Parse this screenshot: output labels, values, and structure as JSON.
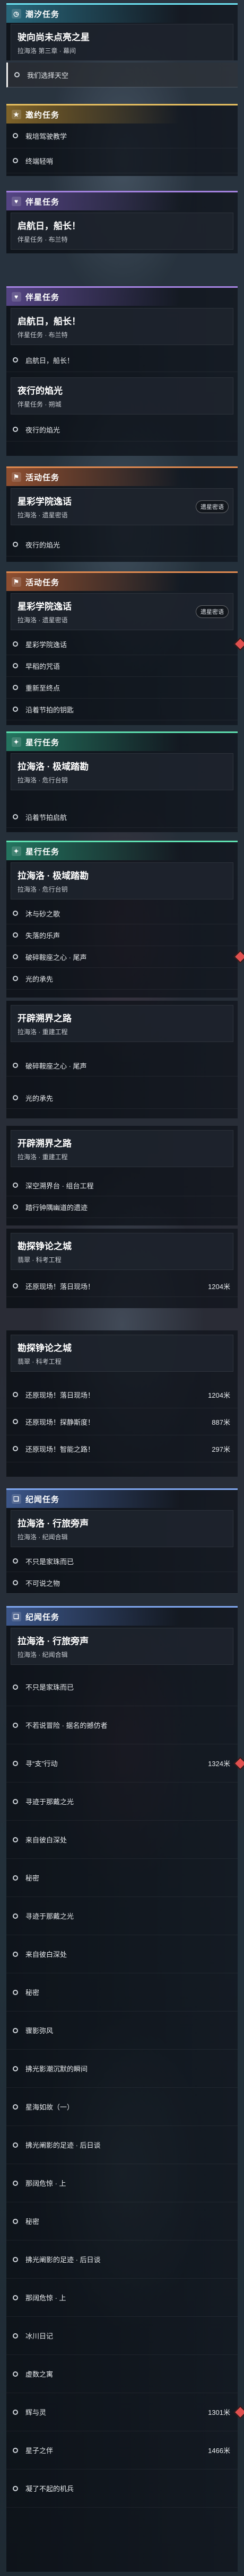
{
  "colors": {
    "daily": "#6be0f0",
    "errand": "#e8c060",
    "companion": "#a482e0",
    "event": "#e08a50",
    "star": "#5ee0b0",
    "trailblaze": "#80a8f0",
    "bounty": "#e0504f"
  },
  "icons": {
    "daily": "clock-icon",
    "errand": "star-icon",
    "companion": "heart-icon",
    "event": "flag-icon",
    "star": "sparkle-icon",
    "trailblaze": "book-icon",
    "bounty": "diamond-icon"
  },
  "s1": {
    "head": "潮汐任务",
    "quest": {
      "title": "驶向尚未点亮之星",
      "sub": "拉海洛 第三章 · 幕间"
    },
    "items": [
      "我们选择天空"
    ]
  },
  "s2": {
    "head": "邀约任务",
    "items": [
      "栽培驾驶教学",
      "终端轻哨"
    ]
  },
  "s3": {
    "head": "伴星任务",
    "quest": {
      "title": "启航日，船长！",
      "sub": "伴星任务 · 布兰特"
    }
  },
  "s4": {
    "head": "伴星任务",
    "quest": {
      "title": "启航日，船长！",
      "sub": "伴星任务 · 布兰特"
    },
    "items": [
      "启航日，船长！"
    ],
    "quest2": {
      "title": "夜行的焰光",
      "sub": "伴星任务 · 朔城"
    },
    "items2": [
      "夜行的焰光"
    ]
  },
  "s5": {
    "head": "活动任务",
    "quest": {
      "title": "星彩学院逸话",
      "sub": "拉海洛 · 遗星密语",
      "badge": "遗星密语"
    },
    "items": [
      "夜行的焰光"
    ]
  },
  "s6": {
    "head": "活动任务",
    "quest": {
      "title": "星彩学院逸话",
      "sub": "拉海洛 · 遗星密语",
      "badge": "遗星密语"
    },
    "items": [
      "星彩学院逸话",
      "早稻的咒语",
      "重新至终点",
      "沿着节拍的钥匙"
    ]
  },
  "s7": {
    "head": "星行任务",
    "quest": {
      "title": "拉海洛 · 极域踏勘",
      "sub": "拉海洛 · 危行台钥"
    },
    "items": [
      "沿着节拍启航"
    ]
  },
  "s8": {
    "head": "星行任务",
    "quest": {
      "title": "拉海洛 · 极域踏勘",
      "sub": "拉海洛 · 危行台钥"
    },
    "items": [
      "沐与砂之歌",
      "失落的乐声",
      "破碎鞍座之心 · 尾声",
      "光的承先"
    ]
  },
  "s9": {
    "quest": {
      "title": "开辟溯界之路",
      "sub": "拉海洛 · 重建工程"
    },
    "items": [
      "破碎鞍座之心 · 尾声",
      "光的承先"
    ]
  },
  "s10": {
    "quest": {
      "title": "开辟溯界之路",
      "sub": "拉海洛 · 重建工程"
    },
    "items": [
      "深空溯界台 · 组台工程",
      "踏行钟隅幽道的遗迹"
    ]
  },
  "s11": {
    "quest": {
      "title": "勘探铮论之城",
      "sub": "翡翠 · 科考工程"
    },
    "items": [
      {
        "label": "还原现场！落日现场！",
        "val": "1204米"
      }
    ]
  },
  "s12": {
    "quest": {
      "title": "勘探铮论之城",
      "sub": "翡翠 · 科考工程"
    },
    "items": [
      {
        "label": "还原现场！落日现场！",
        "val": "1204米"
      },
      {
        "label": "还原现场！探静斯度！",
        "val": "887米"
      },
      {
        "label": "还原现场！智能之路！",
        "val": "297米"
      }
    ]
  },
  "s13": {
    "head": "纪闻任务",
    "quest": {
      "title": "拉海洛 · 行旅旁声",
      "sub": "拉海洛 · 纪闻合辑"
    },
    "items": [
      "不只是家珠而已",
      "不可说之物"
    ]
  },
  "s14": {
    "head": "纪闻任务",
    "quest": {
      "title": "拉海洛 · 行旅旁声",
      "sub": "拉海洛 · 纪闻合辑"
    },
    "items": [
      {
        "label": "不只是家珠而已",
        "val": ""
      },
      {
        "label": "不若说冒险 · 据名的撼仿者",
        "val": ""
      },
      {
        "label": "寻“支”行动",
        "val": "1324米"
      },
      {
        "label": "寻迹于那戴之光",
        "val": ""
      },
      {
        "label": "来自彼白深处",
        "val": ""
      },
      {
        "label": "秘密",
        "val": ""
      },
      {
        "label": "寻迹于那戴之光",
        "val": ""
      },
      {
        "label": "来自彼白深处",
        "val": ""
      },
      {
        "label": "秘密",
        "val": ""
      },
      {
        "label": "骤影弥风",
        "val": ""
      },
      {
        "label": "拂光影潮沉默的瞬间",
        "val": ""
      },
      {
        "label": "星海如故（一）",
        "val": ""
      },
      {
        "label": "拂光阐影的足迹 · 后日谈",
        "val": ""
      },
      {
        "label": "那阔危惊 · 上",
        "val": ""
      },
      {
        "label": "秘密",
        "val": ""
      },
      {
        "label": "拂光阐影的足迹 · 后日谈",
        "val": ""
      },
      {
        "label": "那阔危惊 · 上",
        "val": ""
      },
      {
        "label": "冰川日记",
        "val": ""
      },
      {
        "label": "虚数之寓",
        "val": ""
      },
      {
        "label": "辉与灵",
        "val": "1301米"
      },
      {
        "label": "星子之伴",
        "val": "1466米"
      },
      {
        "label": "凝了不起的机兵",
        "val": ""
      }
    ]
  }
}
